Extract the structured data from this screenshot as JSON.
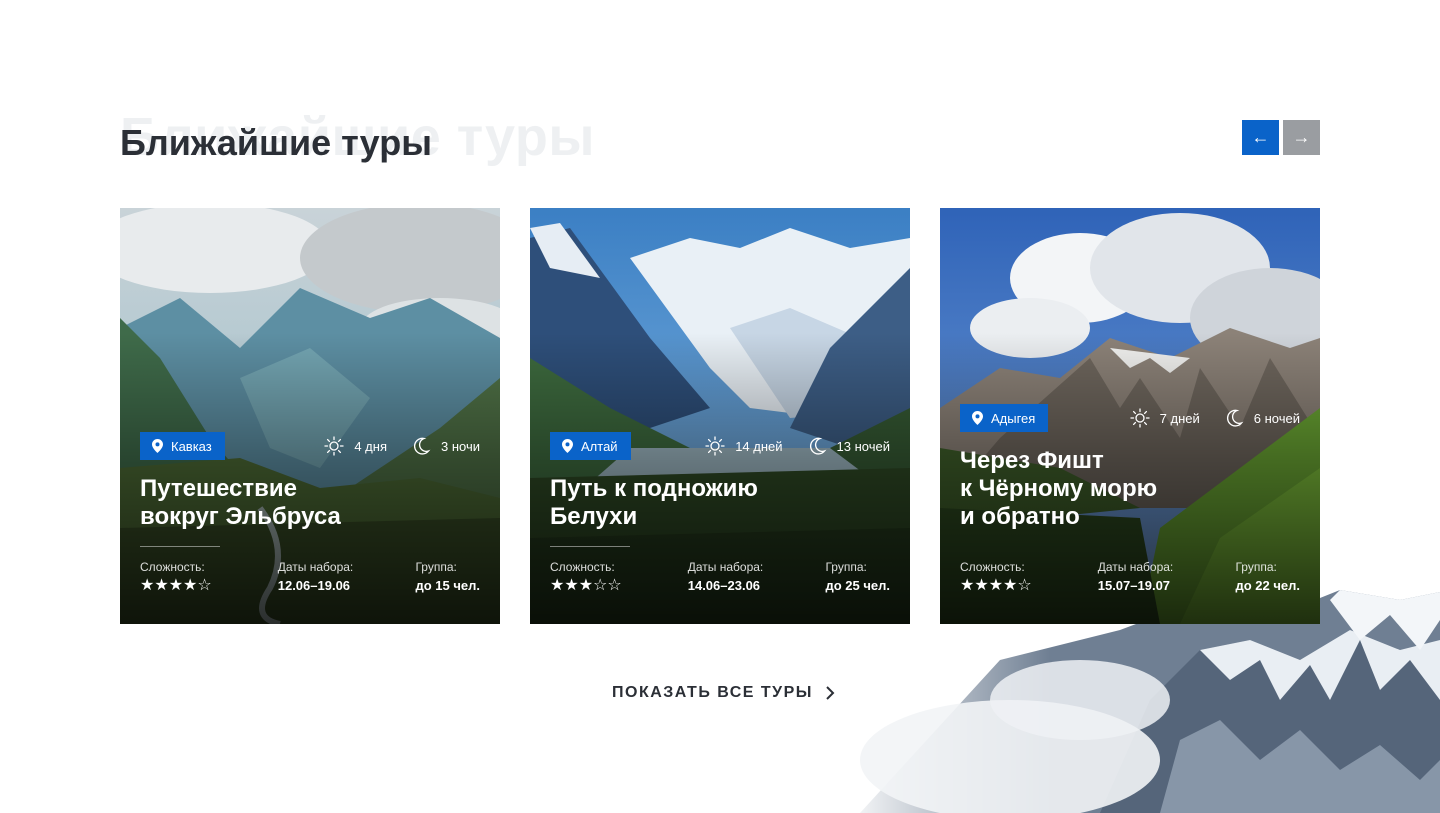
{
  "section": {
    "title": "Ближайшие туры",
    "title_ghost": "Ближайшие туры"
  },
  "nav": {
    "prev_symbol": "←",
    "next_symbol": "→"
  },
  "labels": {
    "difficulty": "Сложность:",
    "dates": "Даты набора:",
    "group": "Группа:"
  },
  "tours": [
    {
      "region": "Кавказ",
      "days": "4 дня",
      "nights": "3 ночи",
      "title_line1": "Путешествие",
      "title_line2": "вокруг Эльбруса",
      "title_line3": "",
      "difficulty_stars": "★★★★☆",
      "difficulty": 4,
      "dates": "12.06–19.06",
      "group": "до 15 чел."
    },
    {
      "region": "Алтай",
      "days": "14 дней",
      "nights": "13 ночей",
      "title_line1": "Путь к подножию",
      "title_line2": "Белухи",
      "title_line3": "",
      "difficulty_stars": "★★★☆☆",
      "difficulty": 3,
      "dates": "14.06–23.06",
      "group": "до 25 чел."
    },
    {
      "region": "Адыгея",
      "days": "7 дней",
      "nights": "6 ночей",
      "title_line1": "Через Фишт",
      "title_line2": "к Чёрному морю",
      "title_line3": "и обратно",
      "difficulty_stars": "★★★★☆",
      "difficulty": 4,
      "dates": "15.07–19.07",
      "group": "до 22 чел."
    }
  ],
  "show_all": {
    "label": "ПОКАЗАТЬ ВСЕ ТУРЫ"
  },
  "colors": {
    "accent": "#0a63c9",
    "nav_inactive": "#9a9da1",
    "text_dark": "#2b2f36"
  },
  "icons": {
    "region": "map-pin-icon",
    "days": "sun-icon",
    "nights": "moon-icon",
    "more": "chevron-right-icon"
  }
}
